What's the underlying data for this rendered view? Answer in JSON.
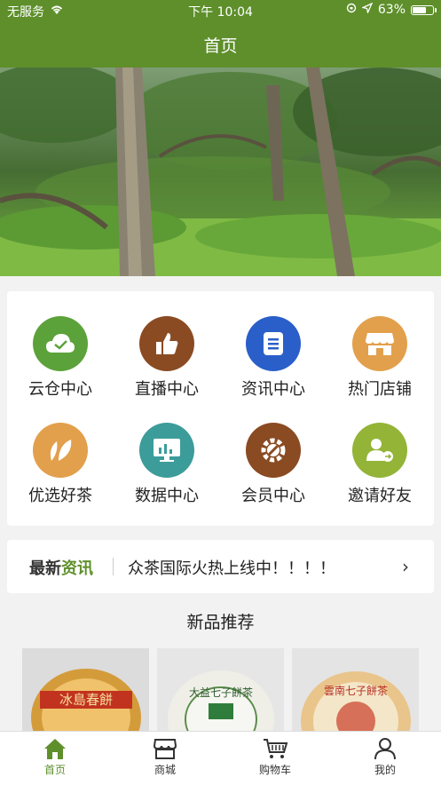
{
  "status_bar": {
    "carrier": "无服务",
    "time": "下午 10:04",
    "battery": "63%",
    "battery_level": 0.63
  },
  "nav": {
    "title": "首页"
  },
  "grid": [
    {
      "label": "云仓中心",
      "icon": "cloud-check-icon",
      "color": "#5ca23a"
    },
    {
      "label": "直播中心",
      "icon": "thumbs-up-icon",
      "color": "#8a4b22"
    },
    {
      "label": "资讯中心",
      "icon": "document-icon",
      "color": "#2a5fc9"
    },
    {
      "label": "热门店铺",
      "icon": "store-icon",
      "color": "#e2a04c"
    },
    {
      "label": "优选好茶",
      "icon": "tea-leaf-icon",
      "color": "#e2a04c"
    },
    {
      "label": "数据中心",
      "icon": "monitor-chart-icon",
      "color": "#3c9c9a"
    },
    {
      "label": "会员中心",
      "icon": "gear-wrench-icon",
      "color": "#8a4b22"
    },
    {
      "label": "邀请好友",
      "icon": "user-invite-icon",
      "color": "#93b437"
    }
  ],
  "news": {
    "tag_part1": "最新",
    "tag_part2": "资讯",
    "text": "众茶国际火热上线中！！！！",
    "arrow": "›"
  },
  "section_title": "新品推荐",
  "products": [
    {
      "label": "冰島春餅"
    },
    {
      "label": "大益七子餅茶"
    },
    {
      "label": "雲南七子餅茶"
    }
  ],
  "tabs": [
    {
      "label": "首页",
      "icon": "home-icon",
      "active": true
    },
    {
      "label": "商城",
      "icon": "shop-icon",
      "active": false
    },
    {
      "label": "购物车",
      "icon": "cart-icon",
      "active": false
    },
    {
      "label": "我的",
      "icon": "person-icon",
      "active": false
    }
  ],
  "colors": {
    "brand": "#5e8f2b"
  }
}
